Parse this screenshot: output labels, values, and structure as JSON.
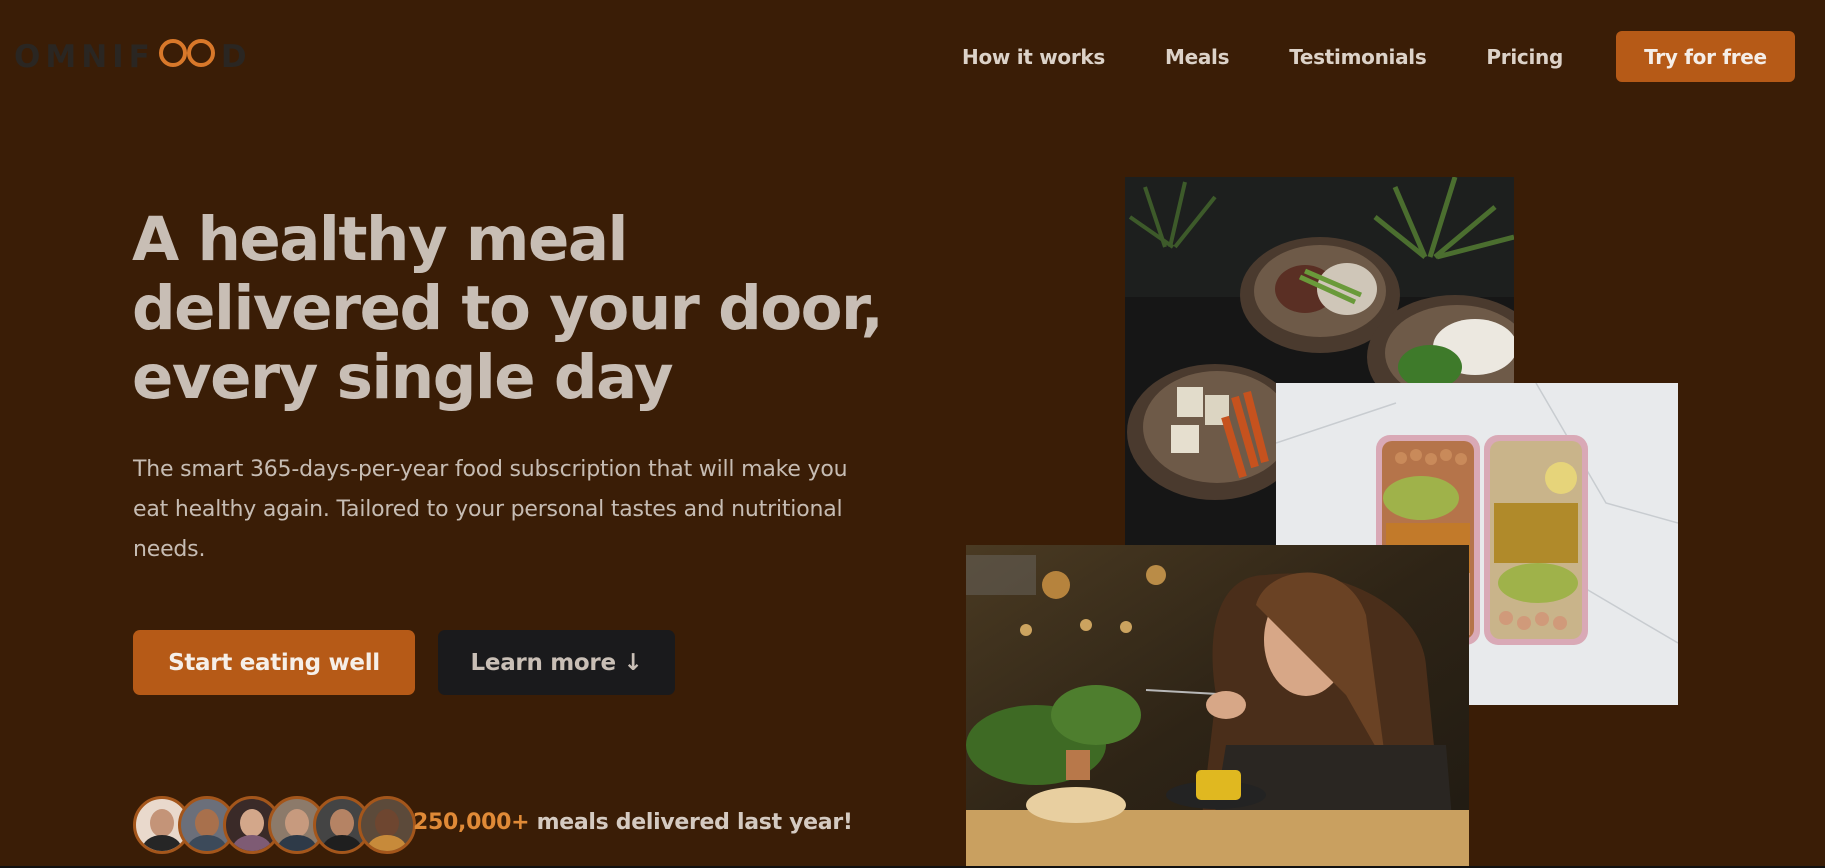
{
  "brand": {
    "name_left": "OMNIF",
    "name_right": "D",
    "logo_mark": "infinity-mark-icon",
    "accent_color": "#b65a17",
    "background_color": "#3a1d06"
  },
  "nav": {
    "items": [
      {
        "label": "How it works"
      },
      {
        "label": "Meals"
      },
      {
        "label": "Testimonials"
      },
      {
        "label": "Pricing"
      }
    ],
    "cta_label": "Try for free"
  },
  "hero": {
    "title_line1": "A healthy meal",
    "title_line2": "delivered to your door,",
    "title_line3": "every single day",
    "description": "The smart 365-days-per-year food subscription that will make you eat healthy again. Tailored to your personal tastes and nutritional needs.",
    "primary_button": "Start eating well",
    "secondary_button": "Learn more ↓",
    "secondary_icon": "arrow-down-icon"
  },
  "social_proof": {
    "count": "250,000+",
    "text": " meals delivered last year!",
    "avatar_count": 6
  },
  "images": {
    "bowls": "food-bowls-photo",
    "boxes": "meal-prep-boxes-photo",
    "woman": "woman-eating-photo"
  }
}
